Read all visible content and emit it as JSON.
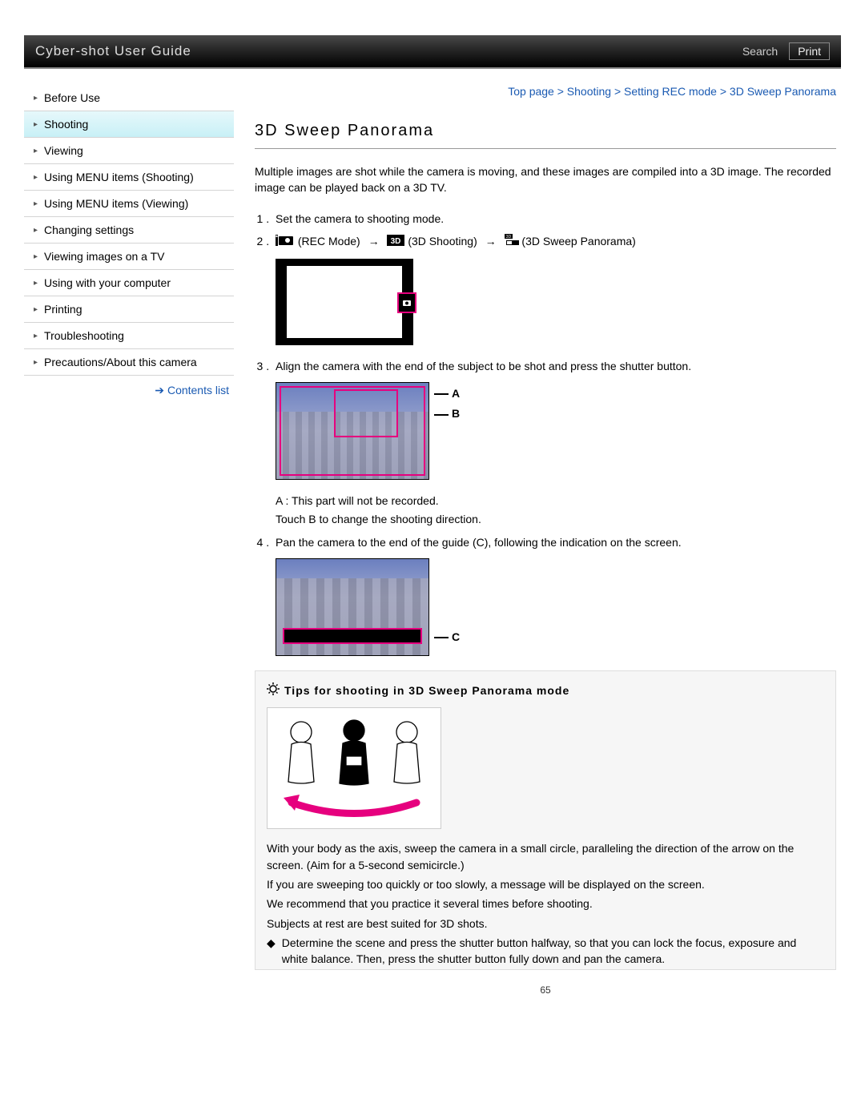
{
  "header": {
    "title": "Cyber-shot User Guide",
    "search": "Search",
    "print": "Print"
  },
  "sidebar": {
    "items": [
      "Before Use",
      "Shooting",
      "Viewing",
      "Using MENU items (Shooting)",
      "Using MENU items (Viewing)",
      "Changing settings",
      "Viewing images on a TV",
      "Using with your computer",
      "Printing",
      "Troubleshooting",
      "Precautions/About this camera"
    ],
    "active_index": 1,
    "contents_list": "Contents list"
  },
  "breadcrumb": "Top page > Shooting > Setting REC mode > 3D Sweep Panorama",
  "page_title": "3D Sweep Panorama",
  "intro": "Multiple images are shot while the camera is moving, and these images are compiled into a 3D image. The recorded image can be played back on a 3D TV.",
  "steps": {
    "s1": "Set the camera to shooting mode.",
    "s2": {
      "rec_mode": "(REC Mode)",
      "shooting_3d": "(3D Shooting)",
      "sweep_3d": "(3D Sweep Panorama)"
    },
    "s3": "Align the camera with the end of the subject to be shot and press the shutter button.",
    "s3_labels": {
      "a": "A",
      "b": "B"
    },
    "s3_sub_a": "A : This part will not be recorded.",
    "s3_sub_b": "Touch B to change the shooting direction.",
    "s4": "Pan the camera to the end of the guide (C), following the indication on the screen.",
    "s4_label": "C"
  },
  "tips": {
    "header": "Tips for shooting in 3D Sweep Panorama mode",
    "p1": "With your body as the axis, sweep the camera in a small circle, paralleling the direction of the arrow on the screen. (Aim for a 5-second semicircle.)",
    "p2": "If you are sweeping too quickly or too slowly, a message will be displayed on the screen.",
    "p3": "We recommend that you practice it several times before shooting.",
    "p4": "Subjects at rest are best suited for 3D shots.",
    "bullet1": "Determine the scene and press the shutter button halfway, so that you can lock the focus, exposure and white balance. Then, press the shutter button fully down and pan the camera."
  },
  "page_number": "65"
}
